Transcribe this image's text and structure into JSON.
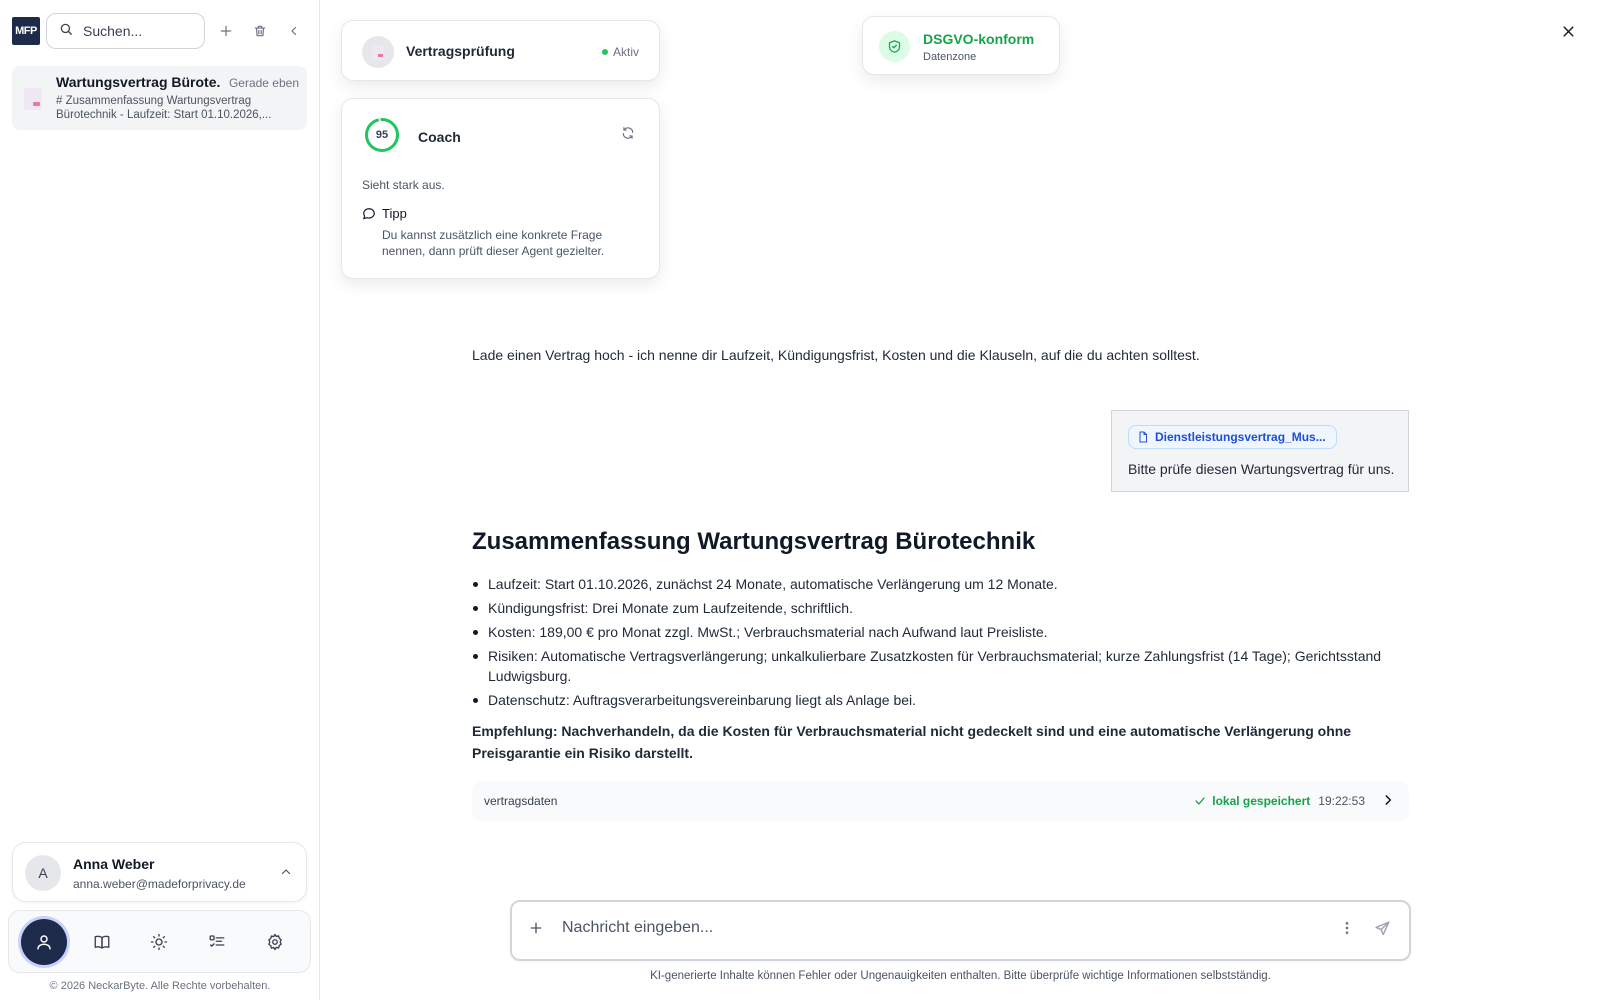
{
  "brand": {
    "logo_text": "MFP"
  },
  "sidebar": {
    "search_placeholder": "Suchen...",
    "chats": [
      {
        "title": "Wartungsvertrag Bürote...",
        "time": "Gerade eben",
        "preview": "# Zusammenfassung Wartungsvertrag Bürotechnik - Laufzeit: Start 01.10.2026,..."
      }
    ],
    "user": {
      "initial": "A",
      "name": "Anna Weber",
      "email": "anna.weber@madeforprivacy.de"
    },
    "nav_icons": [
      "user-icon",
      "book-icon",
      "sun-icon",
      "checklist-icon",
      "gear-icon"
    ],
    "copyright": "© 2026 NeckarByte. Alle Rechte vorbehalten."
  },
  "agent": {
    "name": "Vertragsprüfung",
    "status": "Aktiv",
    "status_color": "#22c55e"
  },
  "coach": {
    "score": "95",
    "score_fraction": 0.95,
    "title": "Coach",
    "message": "Sieht stark aus.",
    "tip_title": "Tipp",
    "tip_text": "Du kannst zusätzlich eine konkrete Frage nennen, dann prüft dieser Agent gezielter."
  },
  "compliance": {
    "title": "DSGVO-konform",
    "subtitle": "Datenzone",
    "color": "#16a34a"
  },
  "conversation": {
    "intro": "Lade einen Vertrag hoch - ich nenne dir Laufzeit, Kündigungsfrist, Kosten und die Klauseln, auf die du achten solltest.",
    "user_message": {
      "attachment": "Dienstleistungsvertrag_Mus...",
      "text": "Bitte prüfe diesen Wartungsvertrag für uns."
    },
    "summary": {
      "title": "Zusammenfassung Wartungsvertrag Bürotechnik",
      "items": [
        "Laufzeit: Start 01.10.2026, zunächst 24 Monate, automatische Verlängerung um 12 Monate.",
        "Kündigungsfrist: Drei Monate zum Laufzeitende, schriftlich.",
        "Kosten: 189,00 € pro Monat zzgl. MwSt.; Verbrauchsmaterial nach Aufwand laut Preisliste.",
        "Risiken: Automatische Vertragsverlängerung; unkalkulierbare Zusatzkosten für Verbrauchsmaterial; kurze Zahlungsfrist (14 Tage); Gerichtsstand Ludwigsburg.",
        "Datenschutz: Auftragsverarbeitungsvereinbarung liegt als Anlage bei."
      ],
      "recommendation": "Empfehlung: Nachverhandeln, da die Kosten für Verbrauchsmaterial nicht gedeckelt sind und eine automatische Verlängerung ohne Preisgarantie ein Risiko darstellt."
    },
    "data_bar": {
      "label": "vertragsdaten",
      "status": "lokal gespeichert",
      "time": "19:22:53"
    }
  },
  "composer": {
    "placeholder": "Nachricht eingeben...",
    "disclaimer": "KI-generierte Inhalte können Fehler oder Ungenauigkeiten enthalten. Bitte überprüfe wichtige Informationen selbstständig."
  }
}
